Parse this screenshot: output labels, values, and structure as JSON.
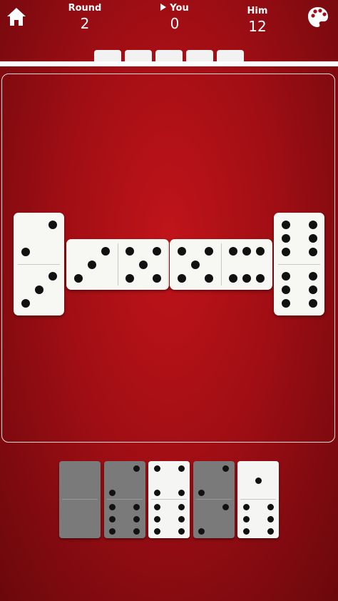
{
  "header": {
    "round": {
      "label": "Round",
      "value": "2"
    },
    "you": {
      "label": "You",
      "value": "0"
    },
    "him": {
      "label": "Him",
      "value": "12"
    },
    "home_icon": "home-icon",
    "palette_icon": "palette-icon"
  },
  "boneyard": {
    "count": 5
  },
  "board": {
    "tiles": [
      {
        "values": [
          2,
          3
        ],
        "orientation": "vertical"
      },
      {
        "values": [
          3,
          5
        ],
        "orientation": "horizontal"
      },
      {
        "values": [
          5,
          6
        ],
        "orientation": "horizontal"
      },
      {
        "values": [
          6,
          6
        ],
        "orientation": "vertical"
      }
    ]
  },
  "hand": {
    "tiles": [
      {
        "values": [
          0,
          0
        ],
        "playable": false
      },
      {
        "values": [
          2,
          6
        ],
        "playable": false
      },
      {
        "values": [
          4,
          6
        ],
        "playable": true
      },
      {
        "values": [
          2,
          2
        ],
        "playable": false
      },
      {
        "values": [
          1,
          6
        ],
        "playable": true
      }
    ]
  },
  "colors": {
    "felt": "#a00e14",
    "tile": "#f7f7f4",
    "pip": "#111111",
    "disabled_tile": "#7a7a7a"
  }
}
